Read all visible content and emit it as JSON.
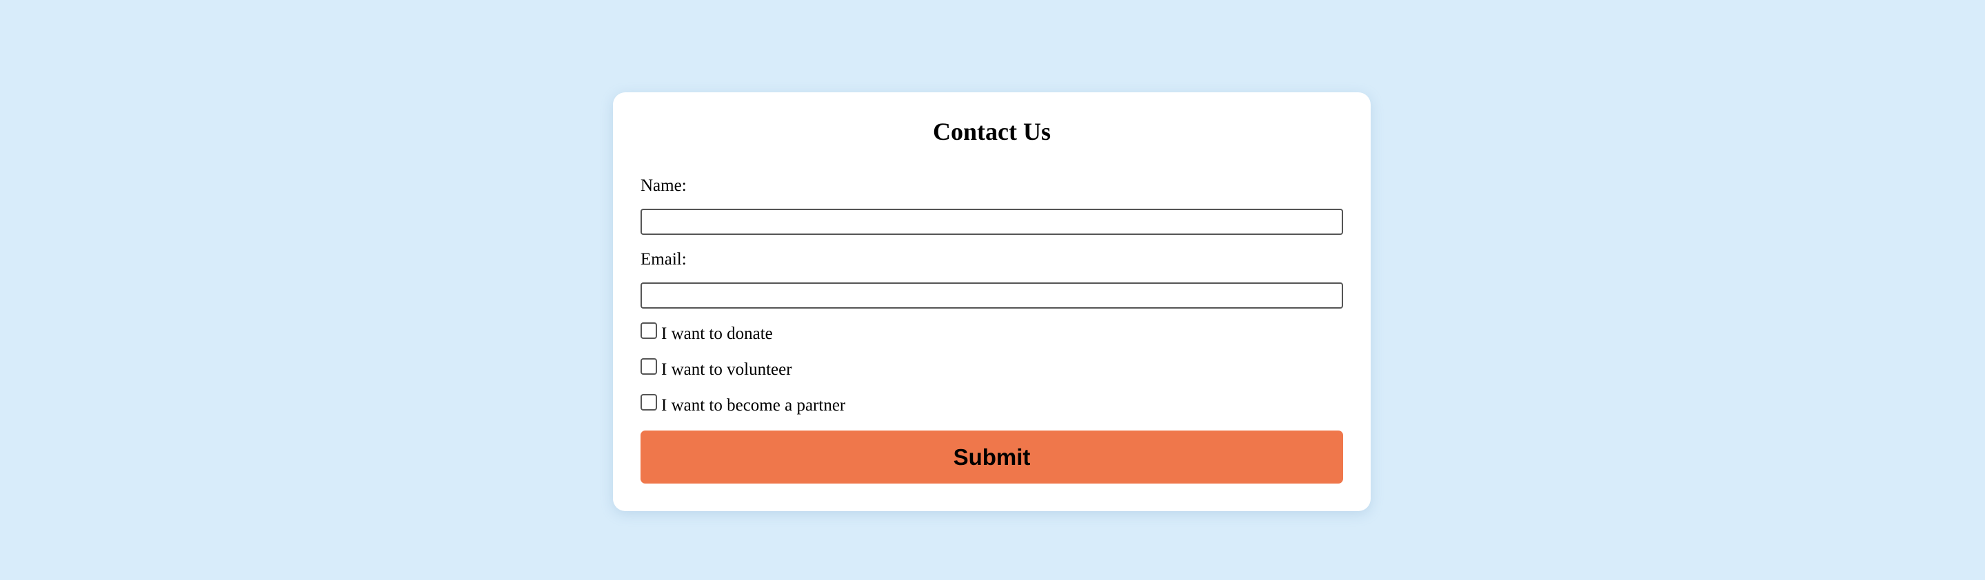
{
  "form": {
    "title": "Contact Us",
    "fields": {
      "name": {
        "label": "Name:",
        "value": "",
        "placeholder": ""
      },
      "email": {
        "label": "Email:",
        "value": "",
        "placeholder": ""
      }
    },
    "options": [
      {
        "label": "I want to donate",
        "checked": false
      },
      {
        "label": "I want to volunteer",
        "checked": false
      },
      {
        "label": "I want to become a partner",
        "checked": false
      }
    ],
    "submit_label": "Submit"
  },
  "colors": {
    "background": "#d8ecfa",
    "card": "#ffffff",
    "accent": "#ef774b"
  }
}
